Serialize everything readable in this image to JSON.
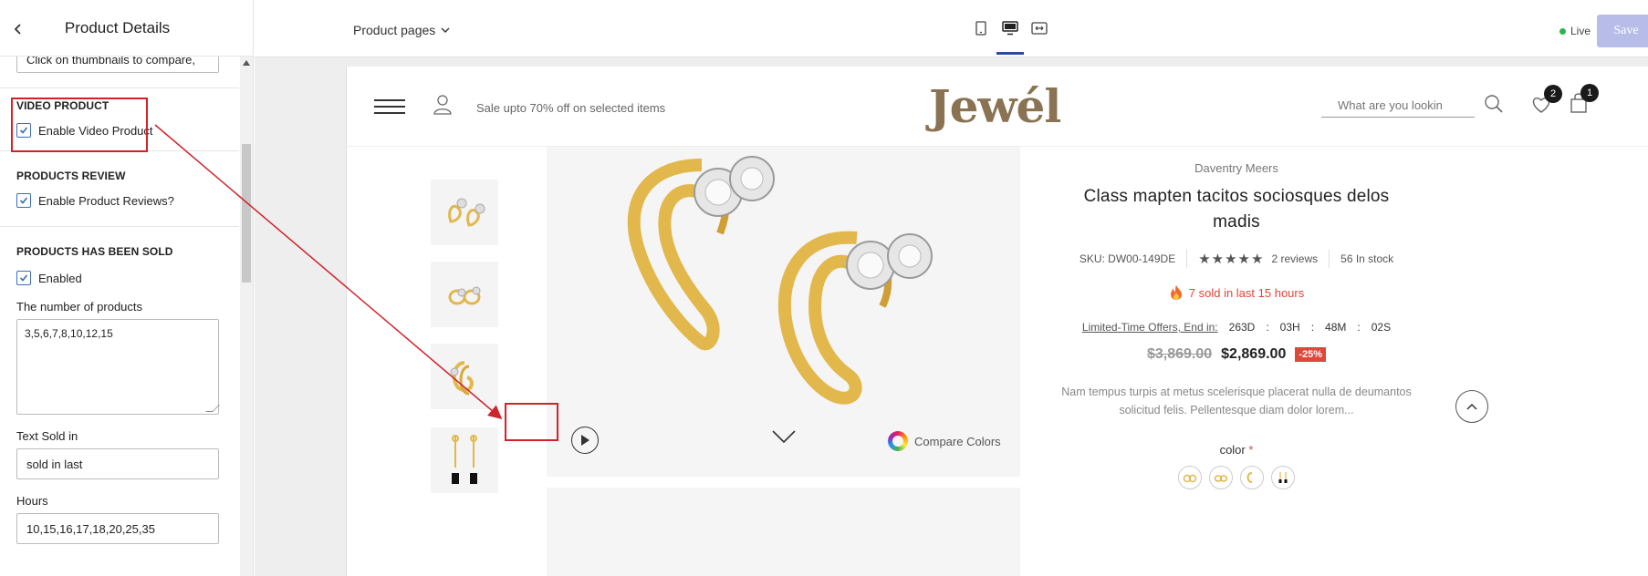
{
  "panel": {
    "title": "Product Details",
    "compare_input_value": "Click on thumbnails to compare,",
    "video": {
      "section_title": "VIDEO PRODUCT",
      "checkbox_label": "Enable Video Product"
    },
    "reviews": {
      "section_title": "PRODUCTS REVIEW",
      "checkbox_label": "Enable Product Reviews?"
    },
    "sold": {
      "section_title": "PRODUCTS HAS BEEN SOLD",
      "checkbox_label": "Enabled",
      "number_label": "The number of products",
      "number_value": "3,5,6,7,8,10,12,15",
      "text_sold_label": "Text Sold in",
      "text_sold_value": "sold in last",
      "hours_label": "Hours",
      "hours_value": "10,15,16,17,18,20,25,35"
    }
  },
  "topbar": {
    "page_select": "Product pages",
    "status": "Live",
    "save_label": "Save"
  },
  "store": {
    "promo": "Sale upto 70% off on selected items",
    "logo": "Jewél",
    "search_placeholder": "What are you lookin",
    "wishlist_count": "2",
    "cart_count": "1"
  },
  "product": {
    "vendor": "Daventry Meers",
    "title": "Class mapten tacitos sociosques delos madis",
    "sku_label": "SKU:",
    "sku": "DW00-149DE",
    "stars": "★★★★★",
    "reviews": "2 reviews",
    "stock": "56 In stock",
    "sold_text": "7 sold in last 15 hours",
    "countdown_label": "Limited-Time Offers, End in:",
    "countdown": [
      "263D",
      ":",
      "03H",
      ":",
      "48M",
      ":",
      "02S"
    ],
    "old_price": "$3,869.00",
    "new_price": "$2,869.00",
    "discount": "-25%",
    "description": "Nam tempus turpis at metus scelerisque placerat nulla de deumantos solicitud felis. Pellentesque diam dolor lorem...",
    "color_label": "color",
    "required_mark": "*",
    "compare_colors": "Compare Colors"
  },
  "colors": {
    "accent": "#2c4a9a",
    "highlight": "#d0222b",
    "logo": "#8a7352",
    "gold": "#e2b84d",
    "sale": "#e0463a",
    "save_btn": "#b7bde8"
  }
}
